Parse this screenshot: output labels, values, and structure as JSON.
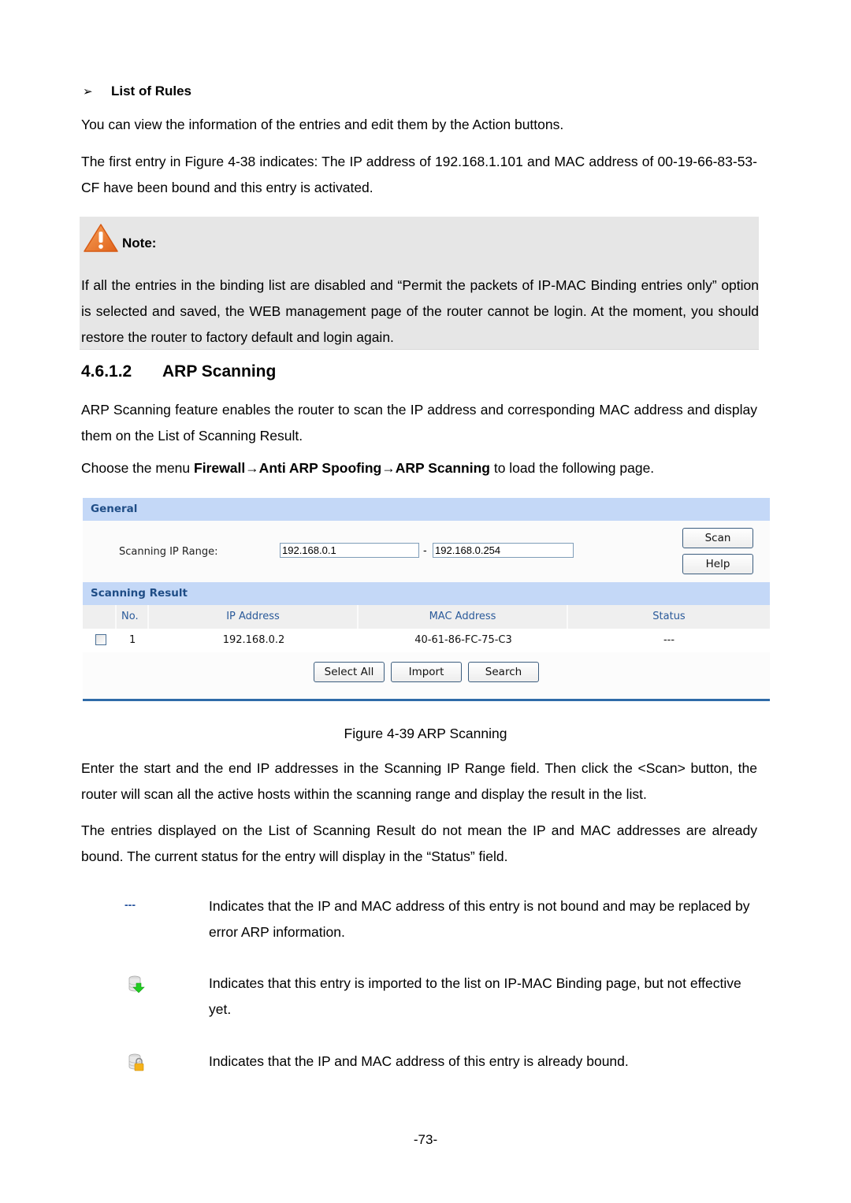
{
  "list_of_rules": {
    "heading": "List of Rules",
    "para1": "You can view the information of the entries and edit them by the Action buttons.",
    "para2": "The first entry in Figure 4-38 indicates: The IP address of 192.168.1.101 and MAC address of 00-19-66-83-53-CF have been bound and this entry is activated."
  },
  "note": {
    "title": "Note:",
    "icon": "warning-icon",
    "text": "If all the entries in the binding list are disabled and “Permit the packets of IP-MAC Binding entries only” option is selected and saved, the WEB management page of the router cannot be login. At the moment, you should restore the router to factory default and login again."
  },
  "section": {
    "number": "4.6.1.2",
    "title": "ARP Scanning",
    "intro": "ARP Scanning feature enables the router to scan the IP address and corresponding MAC address and display them on the List of Scanning Result.",
    "menu_prefix": "Choose the menu ",
    "menu_path": "Firewall→Anti ARP Spoofing→ARP Scanning",
    "menu_suffix": " to load the following page."
  },
  "ui": {
    "general_title": "General",
    "range_label": "Scanning IP Range:",
    "start_ip": "192.168.0.1",
    "range_separator": "-",
    "end_ip": "192.168.0.254",
    "scan_button": "Scan",
    "help_button": "Help",
    "result_title": "Scanning Result",
    "columns": [
      "No.",
      "IP Address",
      "MAC Address",
      "Status"
    ],
    "rows": [
      {
        "no": "1",
        "ip": "192.168.0.2",
        "mac": "40-61-86-FC-75-C3",
        "status": "---",
        "checked": false
      }
    ],
    "select_all_button": "Select All",
    "import_button": "Import",
    "search_button": "Search"
  },
  "caption": "Figure 4-39 ARP Scanning",
  "body": {
    "para1": "Enter the start and the end IP addresses in the Scanning IP Range field. Then click the <Scan> button, the router will scan all the active hosts within the scanning range and display the result in the list.",
    "para2": "The entries displayed on the List of Scanning Result do not mean the IP and MAC addresses are already bound. The current status for the entry will display in the “Status” field."
  },
  "status_legend": [
    {
      "symbol": "---",
      "icon": "not-bound-dash",
      "text": "Indicates that the IP and MAC address of this entry is not bound and may be replaced by error ARP information."
    },
    {
      "symbol": "",
      "icon": "database-import-icon",
      "text": "Indicates that this entry is imported to the list on IP-MAC Binding page, but not effective yet."
    },
    {
      "symbol": "",
      "icon": "database-lock-icon",
      "text": "Indicates that the IP and MAC address of this entry is already bound."
    }
  ],
  "page_number": "-73-"
}
